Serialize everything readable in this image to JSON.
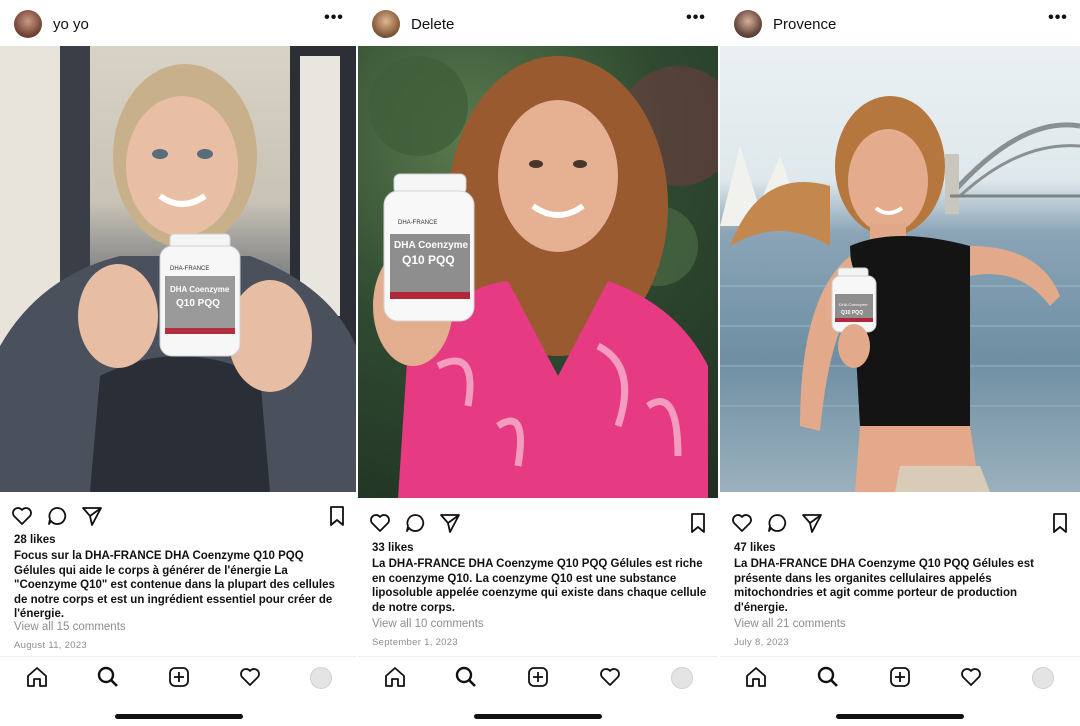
{
  "posts": [
    {
      "username": "yo yo",
      "likes": "28 likes",
      "caption": "Focus sur la DHA-FRANCE DHA Coenzyme Q10 PQQ Gélules qui aide le corps à générer de l'énergie La \"Coenzyme Q10\" est contenue dans la plupart des cellules de notre corps et est un ingrédient essentiel pour créer de l'énergie.",
      "comments": "View all 15 comments",
      "date": "August 11, 2023"
    },
    {
      "username": "Delete",
      "likes": "33 likes",
      "caption": "La DHA-FRANCE DHA Coenzyme Q10 PQQ Gélules est riche en coenzyme Q10. La coenzyme Q10 est une substance liposoluble appelée coenzyme qui existe dans chaque cellule de notre corps.",
      "comments": "View all 10 comments",
      "date": "September 1, 2023"
    },
    {
      "username": "Provence",
      "likes": "47 likes",
      "caption": "La DHA-FRANCE DHA Coenzyme Q10 PQQ Gélules est présente dans les organites cellulaires appelés mitochondries et agit comme porteur de production d'énergie.",
      "comments": "View all 21 comments",
      "date": "July 8, 2023"
    }
  ],
  "product_label": {
    "brand": "DHA-FRANCE",
    "name": "DHA Coenzyme",
    "name2": "Q10 PQQ"
  },
  "icons": {
    "header": [
      "avatar",
      "more-icon"
    ],
    "actions": [
      "heart-icon",
      "comment-icon",
      "share-icon",
      "bookmark-icon"
    ],
    "nav": [
      "home-icon",
      "search-icon",
      "add-icon",
      "heart-icon",
      "profile-icon"
    ]
  },
  "colors": {
    "text": "#111111",
    "muted": "#8e8e8e",
    "background": "#ffffff"
  }
}
